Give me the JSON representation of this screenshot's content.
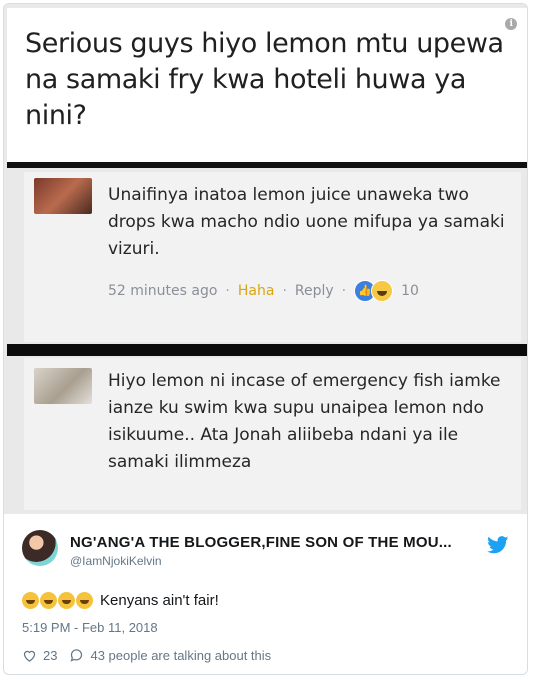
{
  "screenshot": {
    "question": "Serious guys hiyo lemon mtu upewa na samaki fry kwa hoteli huwa ya nini?",
    "info_glyph": "i",
    "comment1": {
      "text": "Unaifinya inatoa lemon juice unaweka two drops kwa macho ndio uone mifupa ya samaki vizuri.",
      "time": "52 minutes ago",
      "dot": "·",
      "haha": "Haha",
      "reply": "Reply",
      "like_glyph": "👍",
      "reactions_count": "10"
    },
    "comment2": {
      "text": "Hiyo lemon ni incase of emergency fish iamke ianze ku swim kwa supu unaipea lemon ndo isikuume.. Ata Jonah aliibeba ndani ya ile samaki ilimmeza"
    }
  },
  "tweet": {
    "display_name": "NG'ANG'A THE BLOGGER,FINE SON OF THE MOU...",
    "handle": "@IamNjokiKelvin",
    "text": "Kenyans ain't fair!",
    "emoji_count": 4,
    "timestamp": "5:19 PM - Feb 11, 2018",
    "likes": "23",
    "talking": "43 people are talking about this",
    "brand_color": "#1da1f2"
  }
}
